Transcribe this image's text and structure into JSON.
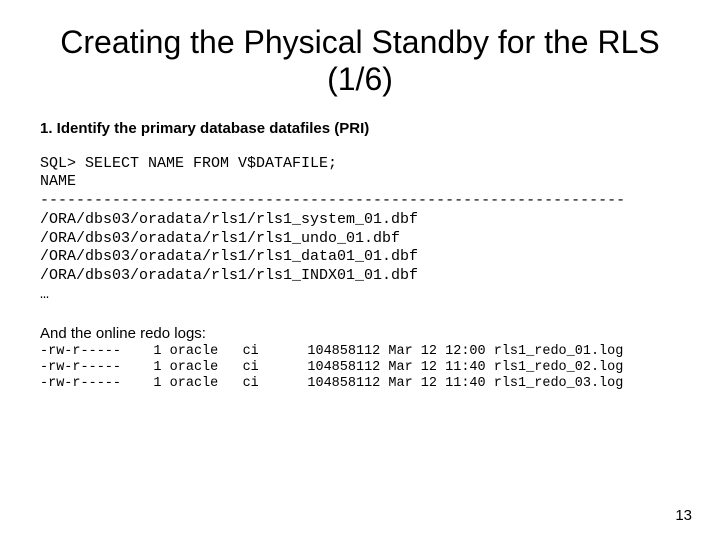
{
  "title": "Creating the Physical Standby for the RLS (1/6)",
  "subhead": "1. Identify the primary database datafiles (PRI)",
  "sql": {
    "prompt_line": "SQL> SELECT NAME FROM V$DATAFILE;",
    "column": "NAME",
    "sep": "-----------------------------------------------------------------",
    "rows": [
      "/ORA/dbs03/oradata/rls1/rls1_system_01.dbf",
      "/ORA/dbs03/oradata/rls1/rls1_undo_01.dbf",
      "/ORA/dbs03/oradata/rls1/rls1_data01_01.dbf",
      "/ORA/dbs03/oradata/rls1/rls1_INDX01_01.dbf"
    ],
    "ellipsis": "…"
  },
  "logs_intro": "And the online redo logs:",
  "logs": [
    {
      "perm": "-rw-r-----",
      "links": "1",
      "owner": "oracle",
      "group": "ci",
      "size": "104858112",
      "date": "Mar 12 12:00",
      "name": "rls1_redo_01.log"
    },
    {
      "perm": "-rw-r-----",
      "links": "1",
      "owner": "oracle",
      "group": "ci",
      "size": "104858112",
      "date": "Mar 12 11:40",
      "name": "rls1_redo_02.log"
    },
    {
      "perm": "-rw-r-----",
      "links": "1",
      "owner": "oracle",
      "group": "ci",
      "size": "104858112",
      "date": "Mar 12 11:40",
      "name": "rls1_redo_03.log"
    }
  ],
  "page_number": "13"
}
